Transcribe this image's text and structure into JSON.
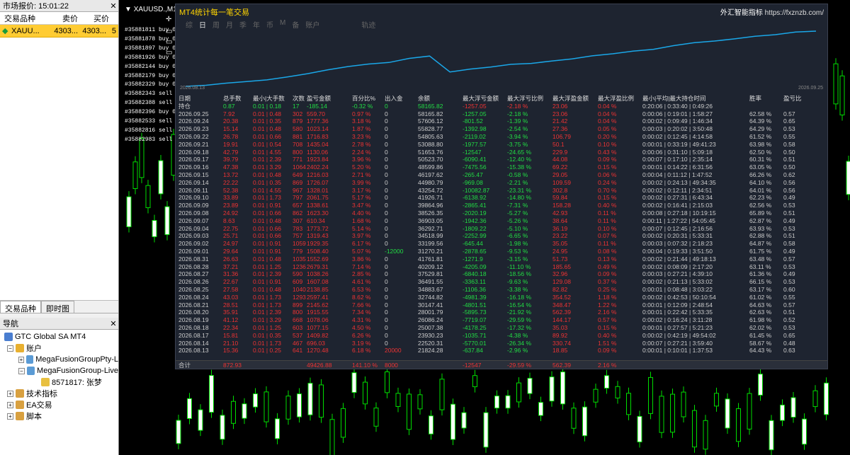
{
  "market_watch": {
    "title": "市场报价: 15:01:22",
    "columns": [
      "交易品种",
      "卖价",
      "买价",
      ""
    ],
    "row": {
      "symbol": "XAUU...",
      "bid": "4303...",
      "ask": "4303...",
      "spread": "5"
    },
    "tabs": [
      "交易品种",
      "即时图"
    ]
  },
  "navigator": {
    "title": "导航",
    "terminal": "GTC Global SA MT4",
    "accounts_label": "账户",
    "server1": "MegaFusionGroupPty-L",
    "server2": "MegaFusionGroup-Live",
    "account": "8571817: 张梦",
    "indicators": "技术指标",
    "ea": "EA交易",
    "scripts": "脚本"
  },
  "chart": {
    "symbol": "XAUUSD.,M15",
    "orders": [
      "#35881811 buy 0.",
      "#35881878 buy 0.",
      "#35881897 buy 0.",
      "#35881926 buy 0.0",
      "#35882144 buy 0.04",
      "#35882179 buy 0.05",
      "#35882329 buy 0.07",
      "#35882343 sell 0.0",
      "#35882388 sell 0.0",
      "#35882396 buy 0.10",
      "#35882533 sell 0.03",
      "#35882816 sell",
      "#35882983 sell 0.7"
    ]
  },
  "stats": {
    "title": "MT4统计每一笔交易",
    "brand": "外汇智能指标",
    "url": "https://fxznzb.com/",
    "tabs": [
      "综",
      "日",
      "周",
      "月",
      "季",
      "年",
      "币",
      "M",
      "备",
      "账户",
      "轨迹"
    ],
    "curve_start": "2026.08.13",
    "curve_end": "2026.09.25",
    "headers": [
      "日期",
      "总手数",
      "最小|大手数",
      "次数",
      "盈亏金额",
      "百分比%",
      "出入金",
      "余额",
      "最大浮亏金额",
      "最大浮亏比例",
      "最大浮盈金额",
      "最大浮盈比例",
      "最小|平均|最大持仓时间",
      "胜率",
      "盈亏比"
    ],
    "holding": [
      "持仓",
      "0.87",
      "0.01 | 0.18",
      "17",
      "-185.14",
      "-0.32 %",
      "0",
      "58165.82",
      "-1257.05",
      "-2.18 %",
      "23.06",
      "0.04 %",
      "0:20:06 | 0:33:40 | 0:49:26",
      "",
      ""
    ],
    "rows": [
      [
        "2026.09.25",
        "7.92",
        "0.01 | 0.48",
        "302",
        "559.70",
        "0.97 %",
        "0",
        "58165.82",
        "-1257.05",
        "-2.18 %",
        "23.06",
        "0.04 %",
        "0:00:06 | 0:19:01 | 1:58:27",
        "62.58 %",
        "0.57"
      ],
      [
        "2026.09.24",
        "20.38",
        "0.01 | 0.35",
        "879",
        "1777.36",
        "3.18 %",
        "0",
        "57606.12",
        "-801.52",
        "-1.39 %",
        "21.42",
        "0.04 %",
        "0:00:02 | 0:09:49 | 1:46:34",
        "64.39 %",
        "0.65"
      ],
      [
        "2026.09.23",
        "15.14",
        "0.01 | 0.48",
        "580",
        "1023.14",
        "1.87 %",
        "0",
        "55828.77",
        "-1392.98",
        "-2.54 %",
        "27.36",
        "0.05 %",
        "0:00:03 | 0:20:02 | 3:50:48",
        "64.29 %",
        "0.53"
      ],
      [
        "2026.09.22",
        "26.78",
        "0.01 | 0.66",
        "881",
        "1716.83",
        "3.23 %",
        "0",
        "54805.63",
        "-2119.02",
        "-3.94 %",
        "106.79",
        "0.20 %",
        "0:00:02 | 0:12:45 | 4:14:58",
        "61.52 %",
        "0.55"
      ],
      [
        "2026.09.21",
        "19.91",
        "0.01 | 0.54",
        "708",
        "1435.04",
        "2.78 %",
        "0",
        "53088.80",
        "-1977.57",
        "-3.75 %",
        "50.1",
        "0.10 %",
        "0:00:01 | 0:33:19 | 49:41:23",
        "63.98 %",
        "0.58"
      ],
      [
        "2026.09.18",
        "42.79",
        "0.01 | 4.55",
        "800",
        "1130.06",
        "2.24 %",
        "0",
        "51653.76",
        "-12547",
        "-24.65 %",
        "229.9",
        "0.43 %",
        "0:00:06 | 0:31:10 | 5:09:18",
        "62.50 %",
        "0.50"
      ],
      [
        "2026.09.17",
        "39.79",
        "0.01 | 2.39",
        "771",
        "1923.84",
        "3.96 %",
        "0",
        "50523.70",
        "-6090.41",
        "-12.40 %",
        "44.08",
        "0.09 %",
        "0:00:07 | 0:17:10 | 2:35:14",
        "60.31 %",
        "0.51"
      ],
      [
        "2026.09.16",
        "47.38",
        "0.01 | 3.29",
        "1064",
        "2402.24",
        "5.20 %",
        "0",
        "48599.86",
        "-7475.56",
        "-15.38 %",
        "69.22",
        "0.15 %",
        "0:00:01 | 0:14:22 | 6:31:56",
        "63.05 %",
        "0.50"
      ],
      [
        "2026.09.15",
        "13.72",
        "0.01 | 0.48",
        "649",
        "1216.03",
        "2.71 %",
        "0",
        "46197.62",
        "-265.47",
        "-0.58 %",
        "29.05",
        "0.06 %",
        "0:00:04 | 0:11:12 | 1:47:52",
        "66.26 %",
        "0.62"
      ],
      [
        "2026.09.14",
        "22.22",
        "0.01 | 0.35",
        "869",
        "1726.07",
        "3.99 %",
        "0",
        "44980.79",
        "-969.08",
        "-2.21 %",
        "109.59",
        "0.24 %",
        "0:00:02 | 0:24:13 | 49:34:35",
        "64.10 %",
        "0.56"
      ],
      [
        "2026.09.11",
        "52.38",
        "0.01 | 4.55",
        "967",
        "1328.01",
        "3.17 %",
        "0",
        "43254.72",
        "-10082.87",
        "-23.31 %",
        "302.8",
        "0.70 %",
        "0:00:02 | 0:12:11 | 2:34:51",
        "64.01 %",
        "0.56"
      ],
      [
        "2026.09.10",
        "33.89",
        "0.01 | 1.73",
        "797",
        "2061.75",
        "5.17 %",
        "0",
        "41926.71",
        "-6138.92",
        "-14.80 %",
        "59.84",
        "0.15 %",
        "0:00:02 | 0:27:31 | 6:43:34",
        "62.23 %",
        "0.49"
      ],
      [
        "2026.09.09",
        "23.89",
        "0.01 | 0.91",
        "657",
        "1338.61",
        "3.47 %",
        "0",
        "39864.96",
        "-2865.41",
        "-7.31 %",
        "158.28",
        "0.40 %",
        "0:00:02 | 0:16:41 | 2:15:03",
        "62.56 %",
        "0.53"
      ],
      [
        "2026.09.08",
        "24.92",
        "0.01 | 0.66",
        "862",
        "1623.30",
        "4.40 %",
        "0",
        "38526.35",
        "-2020.19",
        "-5.27 %",
        "42.93",
        "0.11 %",
        "0:00:08 | 0:27:18 | 10:19:15",
        "65.89 %",
        "0.51"
      ],
      [
        "2026.09.07",
        "8.63",
        "0.01 | 0.48",
        "307",
        "610.34",
        "1.68 %",
        "0",
        "36903.05",
        "-1942.36",
        "-5.26 %",
        "38.64",
        "0.11 %",
        "0:00:11 | 1:27:22 | 54:05:45",
        "62.87 %",
        "0.49"
      ],
      [
        "2026.09.04",
        "22.75",
        "0.01 | 0.66",
        "783",
        "1773.72",
        "5.14 %",
        "0",
        "36292.71",
        "-1809.22",
        "-5.10 %",
        "36.19",
        "0.10 %",
        "0:00:07 | 0:12:45 | 2:16:56",
        "63.93 %",
        "0.53"
      ],
      [
        "2026.09.03",
        "25.71",
        "0.01 | 0.66",
        "757",
        "1319.43",
        "3.97 %",
        "0",
        "34518.99",
        "-2252.99",
        "-6.65 %",
        "23.22",
        "0.07 %",
        "0:00:02 | 0:20:31 | 5:33:31",
        "62.88 %",
        "0.51"
      ],
      [
        "2026.09.02",
        "24.97",
        "0.01 | 0.91",
        "1059",
        "1929.35",
        "6.17 %",
        "0",
        "33199.56",
        "-645.44",
        "-1.98 %",
        "35.05",
        "0.11 %",
        "0:00:03 | 0:07:32 | 2:18:23",
        "64.87 %",
        "0.58"
      ],
      [
        "2026.09.01",
        "29.64",
        "0.01 | 0.91",
        "779",
        "1508.40",
        "5.07 %",
        "-12000",
        "31270.21",
        "-2878.65",
        "-9.53 %",
        "24.95",
        "0.08 %",
        "0:00:04 | 0:19:33 | 3:51:50",
        "61.75 %",
        "0.49"
      ],
      [
        "2026.08.31",
        "26.63",
        "0.01 | 0.48",
        "1035",
        "1552.69",
        "3.86 %",
        "0",
        "41761.81",
        "-1271.9",
        "-3.15 %",
        "51.73",
        "0.13 %",
        "0:00:02 | 0:21:44 | 49:18:13",
        "63.48 %",
        "0.57"
      ],
      [
        "2026.08.28",
        "37.21",
        "0.01 | 1.25",
        "1236",
        "2679.31",
        "7.14 %",
        "0",
        "40209.12",
        "-4205.09",
        "-11.10 %",
        "185.65",
        "0.49 %",
        "0:00:02 | 0:08:09 | 2:17:20",
        "63.11 %",
        "0.53"
      ],
      [
        "2026.08.27",
        "31.36",
        "0.01 | 2.39",
        "590",
        "1038.26",
        "2.85 %",
        "0",
        "37529.81",
        "-6840.18",
        "-18.56 %",
        "32.96",
        "0.09 %",
        "0:00:03 | 0:27:21 | 4:39:10",
        "61.36 %",
        "0.49"
      ],
      [
        "2026.08.26",
        "22.67",
        "0.01 | 0.91",
        "609",
        "1607.08",
        "4.61 %",
        "0",
        "36491.55",
        "-3363.11",
        "-9.63 %",
        "129.08",
        "0.37 %",
        "0:00:02 | 0:21:13 | 5:33:02",
        "66.15 %",
        "0.53"
      ],
      [
        "2026.08.25",
        "27.58",
        "0.01 | 0.48",
        "1040",
        "2138.85",
        "6.53 %",
        "0",
        "34883.67",
        "-1106.36",
        "-3.38 %",
        "82.82",
        "0.25 %",
        "0:00:01 | 0:08:48 | 3:03:22",
        "63.17 %",
        "0.60"
      ],
      [
        "2026.08.24",
        "43.03",
        "0.01 | 1.73",
        "1293",
        "2597.41",
        "8.62 %",
        "0",
        "32744.82",
        "-4981.39",
        "-16.18 %",
        "354.52",
        "1.18 %",
        "0:00:02 | 0:42:53 | 50:10:54",
        "61.02 %",
        "0.55"
      ],
      [
        "2026.08.21",
        "28.51",
        "0.01 | 1.73",
        "899",
        "2145.62",
        "7.66 %",
        "0",
        "30147.41",
        "-4801.51",
        "-16.54 %",
        "348.47",
        "1.22 %",
        "0:00:01 | 0:12:09 | 2:48:54",
        "64.63 %",
        "0.57"
      ],
      [
        "2026.08.20",
        "35.91",
        "0.01 | 2.39",
        "800",
        "1915.55",
        "7.34 %",
        "0",
        "28001.79",
        "-5895.73",
        "-21.92 %",
        "562.39",
        "2.16 %",
        "0:00:01 | 0:22:42 | 5:33:35",
        "62.63 %",
        "0.51"
      ],
      [
        "2026.08.19",
        "41.12",
        "0.01 | 3.29",
        "668",
        "1078.06",
        "4.31 %",
        "0",
        "26086.24",
        "-7719.07",
        "-29.59 %",
        "144.17",
        "0.57 %",
        "0:00:02 | 0:16:24 | 3:11:28",
        "61.98 %",
        "0.52"
      ],
      [
        "2026.08.18",
        "22.34",
        "0.01 | 1.25",
        "603",
        "1077.15",
        "4.50 %",
        "0",
        "25007.38",
        "-4178.25",
        "-17.32 %",
        "35.03",
        "0.15 %",
        "0:00:01 | 0:27:57 | 5:21:23",
        "62.02 %",
        "0.53"
      ],
      [
        "2026.08.17",
        "15.81",
        "0.01 | 0.35",
        "537",
        "1409.82",
        "6.26 %",
        "0",
        "23930.23",
        "-1035.71",
        "-4.38 %",
        "89.92",
        "0.40 %",
        "0:00:02 | 0:42:19 | 49:54:02",
        "61.45 %",
        "0.65"
      ],
      [
        "2026.08.14",
        "21.10",
        "0.01 | 1.73",
        "467",
        "696.03",
        "3.19 %",
        "0",
        "22520.31",
        "-5770.01",
        "-26.34 %",
        "330.74",
        "1.51 %",
        "0:00:07 | 0:27:21 | 3:59:40",
        "58.67 %",
        "0.48"
      ],
      [
        "2026.08.13",
        "15.36",
        "0.01 | 0.25",
        "641",
        "1270.48",
        "6.18 %",
        "20000",
        "21824.28",
        "-637.84",
        "-2.96 %",
        "18.85",
        "0.09 %",
        "0:00:01 | 0:10:01 | 1:37:53",
        "64.43 %",
        "0.63"
      ]
    ],
    "total": [
      "合计",
      "872.93",
      "",
      "",
      "49426.88",
      "141.10 %",
      "8000",
      "",
      "-12547",
      "-29.59 %",
      "562.39",
      "2.16 %",
      "",
      "",
      ""
    ]
  },
  "colors": {
    "panel_bg": "#1e2430",
    "positive": "#22dd44",
    "negative": "#ee3333",
    "curve": "#1aa7e8",
    "title": "#ffd400"
  }
}
